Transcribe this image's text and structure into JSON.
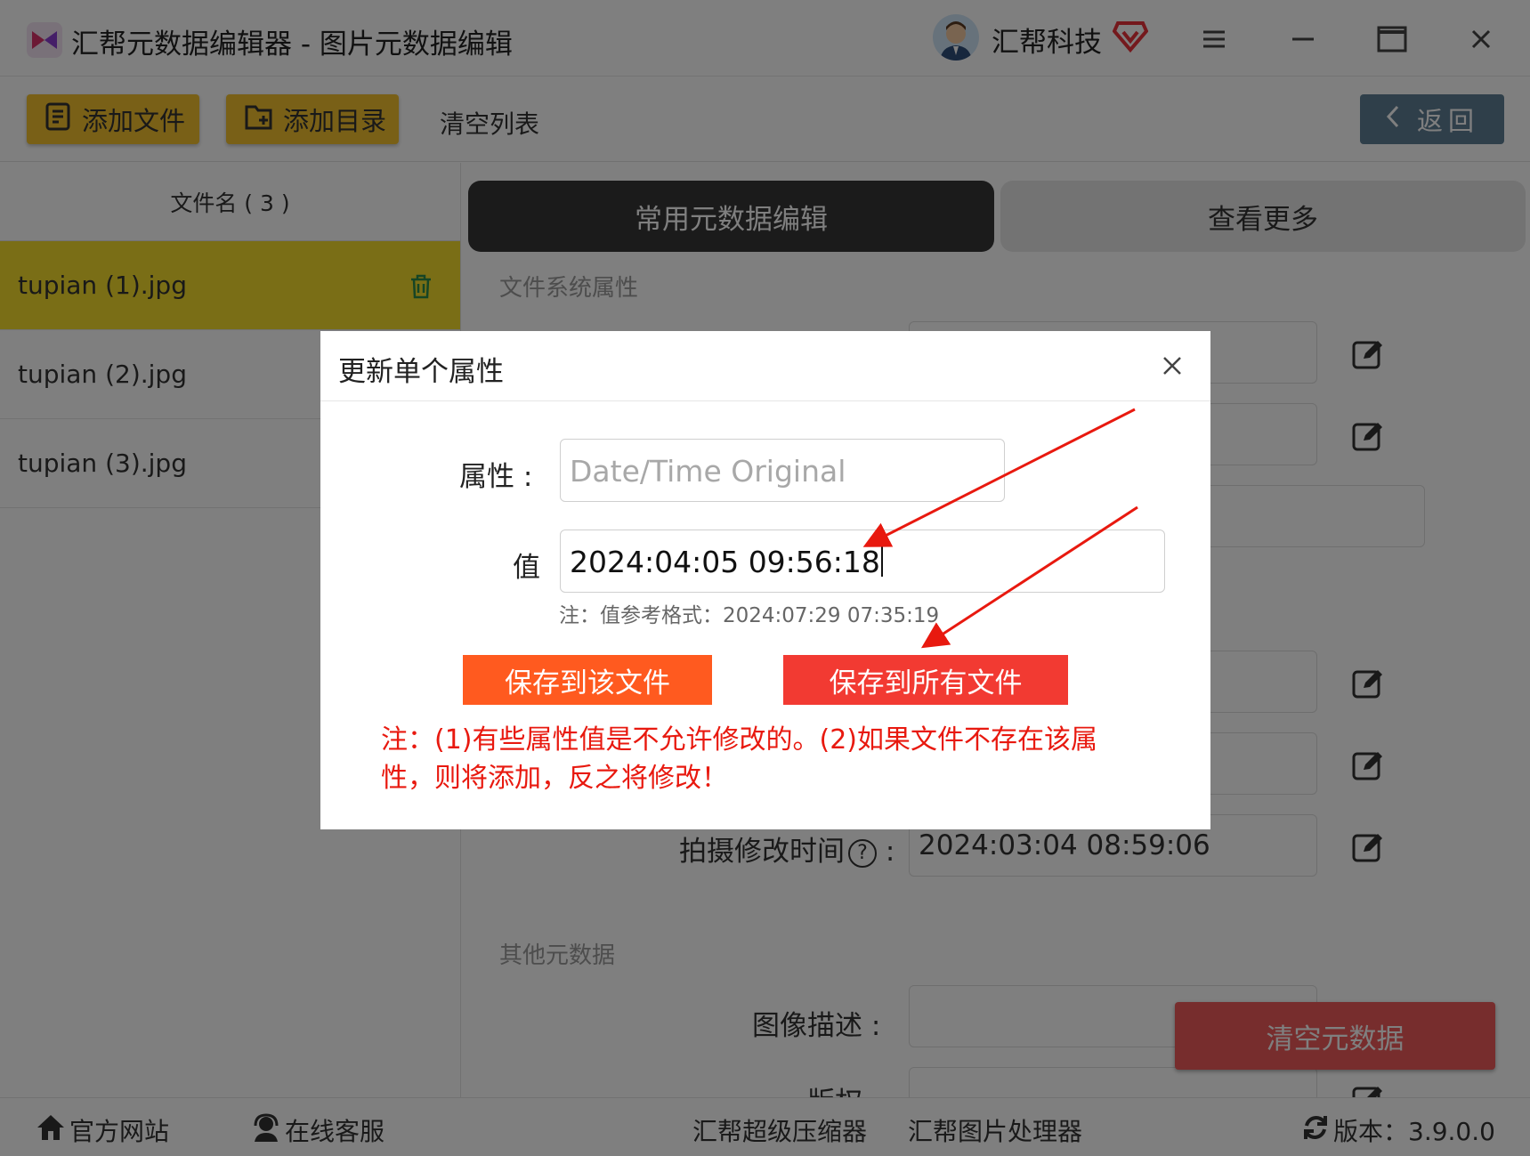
{
  "window": {
    "title": "汇帮元数据编辑器 - 图片元数据编辑",
    "company": "汇帮科技"
  },
  "toolbar": {
    "add_file": "添加文件",
    "add_dir": "添加目录",
    "clear_list": "清空列表",
    "back": "返回"
  },
  "sidebar": {
    "header": "文件名 ( 3 )",
    "files": [
      "tupian (1).jpg",
      "tupian (2).jpg",
      "tupian (3).jpg"
    ]
  },
  "main": {
    "tabs": [
      "常用元数据编辑",
      "查看更多"
    ],
    "section_fs": "文件系统属性",
    "section_other": "其他元数据",
    "modify_time_label": "拍摄修改时间",
    "modify_time_value": "2024:03:04 08:59:06",
    "help_glyph": "?",
    "image_desc_label": "图像描述 :",
    "copyright_label": "版权 :",
    "clear_meta": "清空元数据"
  },
  "dialog": {
    "title": "更新单个属性",
    "property_label": "属性 :",
    "property_value": "Date/Time Original",
    "value_label": "值",
    "value": "2024:04:05 09:56:18",
    "hint": "注：值参考格式：2024:07:29 07:35:19",
    "save_one": "保存到该文件",
    "save_all": "保存到所有文件",
    "note": "注：(1)有些属性值是不允许修改的。(2)如果文件不存在该属性，则将添加，反之将修改！"
  },
  "footer": {
    "official_site": "官方网站",
    "online_service": "在线客服",
    "compressor": "汇帮超级压缩器",
    "image_processor": "汇帮图片处理器",
    "version": "版本：3.9.0.0"
  },
  "colors": {
    "accent_yellow": "#f2c12e",
    "selected_row": "#f5dc2c",
    "dark_tab": "#363636",
    "back_button": "#5e7f95",
    "save_one": "#ff5a1f",
    "save_all": "#f23a32",
    "note_red": "#e8190f"
  }
}
